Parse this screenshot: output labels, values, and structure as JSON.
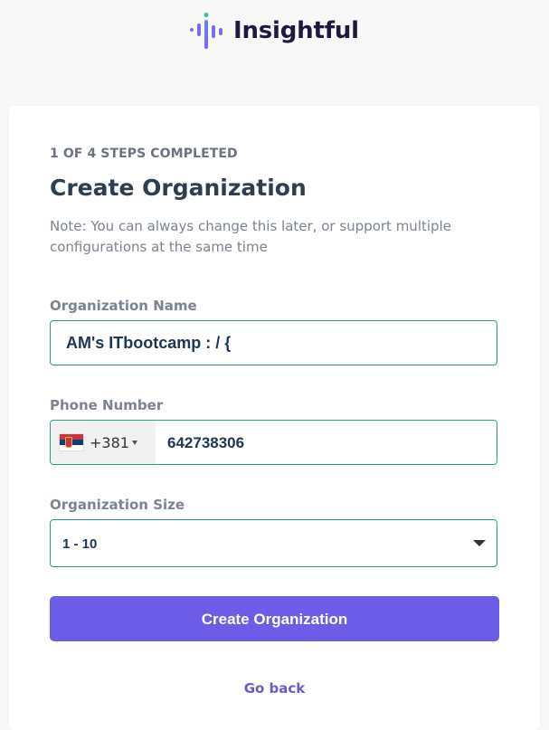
{
  "brand": {
    "name": "Insightful",
    "logo_icon": "insightful-bars-logo",
    "colors": {
      "primary": "#6c5ce7",
      "dark": "#1f1a3d",
      "field_border": "#2a9d8f"
    }
  },
  "form": {
    "progress_text": "1 OF 4 STEPS COMPLETED",
    "title": "Create Organization",
    "note": "Note: You can always change this later, or support multiple configurations at the same time",
    "organization_name": {
      "label": "Organization Name",
      "value": "AM's ITbootcamp : / {"
    },
    "phone": {
      "label": "Phone Number",
      "country_flag": "serbia-flag-icon",
      "dial_code": "+381",
      "value": "642738306"
    },
    "organization_size": {
      "label": "Organization Size",
      "selected": "1 - 10"
    },
    "submit_label": "Create Organization",
    "back_label": "Go back"
  }
}
